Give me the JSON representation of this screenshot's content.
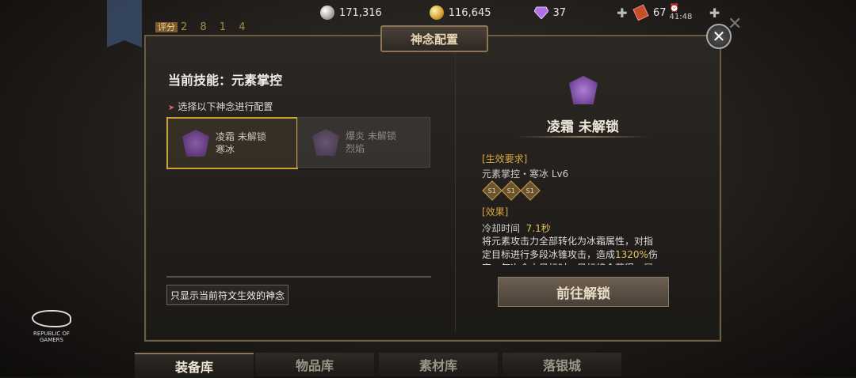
{
  "topbar": {
    "silver": "171,316",
    "gold": "116,645",
    "gems": "37",
    "tickets": "67",
    "time": "41:48"
  },
  "score": {
    "label": "评分",
    "value": "2 8 1 4"
  },
  "dialog": {
    "title": "神念配置",
    "current_skill": "当前技能：元素掌控",
    "select_hint": "选择以下神念进行配置",
    "cards": [
      {
        "name": "凌霜",
        "status": "未解锁",
        "sub": "寒冰"
      },
      {
        "name": "爆炎",
        "status": "未解锁",
        "sub": "烈焰"
      }
    ],
    "filter_label": "只显示当前符文生效的神念",
    "detail": {
      "title": "凌霜 未解锁",
      "req_header": "[生效要求]",
      "req_text": "元素掌控・寒冰 Lv6",
      "sigils": [
        "S1",
        "S1",
        "S1"
      ],
      "effect_header": "[效果]",
      "cooldown_label": "冷却时间",
      "cooldown_value": "7.1秒",
      "desc_a": "将元素攻击力全部转化为冰霜属性，对指定目标进行多段冰锥攻击，造成",
      "desc_pct": "1320%",
      "desc_b": "伤害，每次命中目标时，目标将会获得一层",
      "unlock_button": "前往解锁"
    }
  },
  "tabs": [
    "装备库",
    "物品库",
    "素材库",
    "落银城"
  ],
  "rog": {
    "line1": "REPUBLIC OF",
    "line2": "GAMERS"
  }
}
